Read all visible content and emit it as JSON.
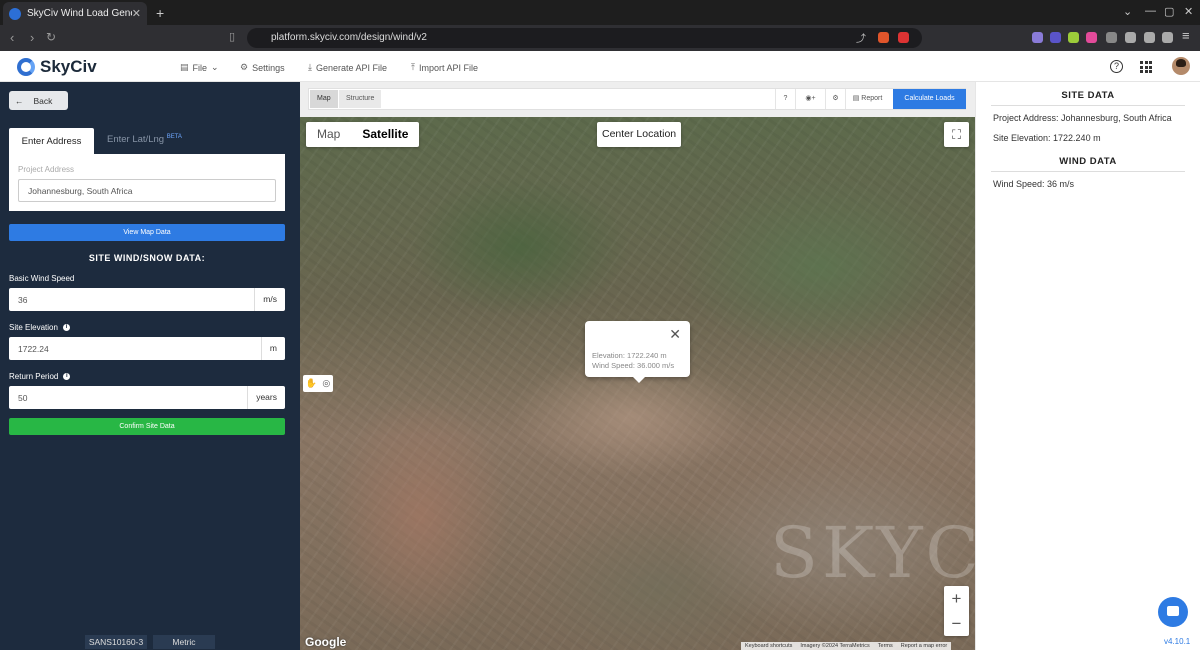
{
  "browser": {
    "tab_title": "SkyCiv Wind Load Generator",
    "url": "platform.skyciv.com/design/wind/v2"
  },
  "header": {
    "brand": "SkyCiv",
    "menu": [
      "File",
      "Settings",
      "Generate API File",
      "Import API File"
    ]
  },
  "left": {
    "back": "Back",
    "tab_address": "Enter Address",
    "tab_latlng": "Enter Lat/Lng",
    "tab_latlng_badge": "BETA",
    "address_label": "Project Address",
    "address_value": "Johannesburg, South Africa",
    "view_map": "View Map Data",
    "section": "SITE WIND/SNOW DATA:",
    "wind_label": "Basic Wind Speed",
    "wind_value": "36",
    "wind_unit": "m/s",
    "elev_label": "Site Elevation",
    "elev_value": "1722.24",
    "elev_unit": "m",
    "return_label": "Return Period",
    "return_value": "50",
    "return_unit": "years",
    "confirm": "Confirm Site Data",
    "code": "SANS10160-3",
    "units": "Metric"
  },
  "map": {
    "seg_map": "Map",
    "seg_structure": "Structure",
    "help": "?",
    "report": "Report",
    "calculate": "Calculate Loads",
    "type_map": "Map",
    "type_satellite": "Satellite",
    "center": "Center Location",
    "popup_elev": "Elevation: 1722.240 m",
    "popup_wind": "Wind Speed: 36.000 m/s",
    "watermark": "SKYC",
    "google": "Google",
    "attr": [
      "Keyboard shortcuts",
      "Imagery ©2024 TerraMetrics",
      "Terms",
      "Report a map error"
    ]
  },
  "right": {
    "site_hdr": "SITE DATA",
    "address": "Project Address: Johannesburg, South Africa",
    "elevation": "Site Elevation: 1722.240 m",
    "wind_hdr": "WIND DATA",
    "wind": "Wind Speed: 36 m/s",
    "version": "v4.10.1"
  }
}
